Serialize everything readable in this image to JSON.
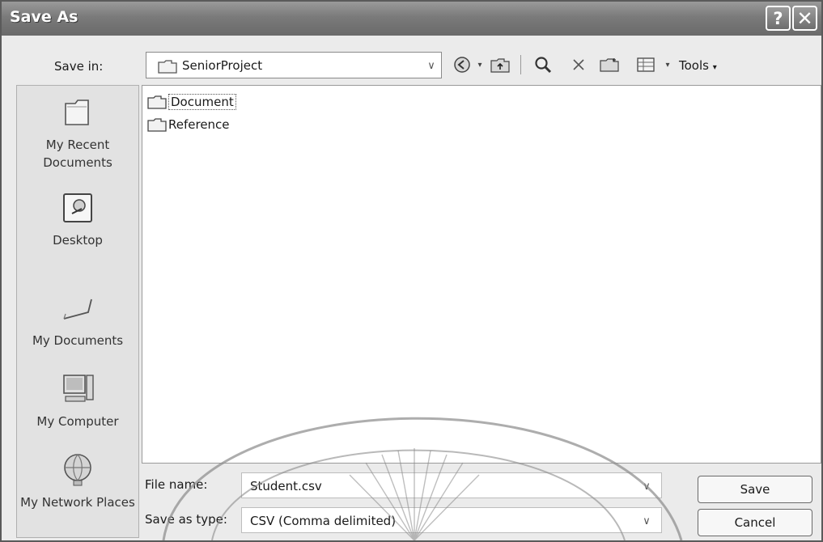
{
  "window": {
    "title": "Save As",
    "help_glyph": "?",
    "close_glyph": "✕"
  },
  "toolbar": {
    "save_in_label": "Save in:",
    "save_in_value": "SeniorProject",
    "icons": [
      "back-icon",
      "dropdown-arrow-icon",
      "up-folder-icon",
      "search-web-icon",
      "delete-icon",
      "new-folder-icon",
      "views-icon",
      "dropdown-arrow-icon"
    ],
    "tools_label": "Tools"
  },
  "places": [
    {
      "label": "My Recent Documents",
      "icon": "recent-documents-icon"
    },
    {
      "label": "Desktop",
      "icon": "desktop-icon"
    },
    {
      "label": "My Documents",
      "icon": "my-documents-icon"
    },
    {
      "label": "My Computer",
      "icon": "my-computer-icon"
    },
    {
      "label": "My Network Places",
      "icon": "network-places-icon"
    }
  ],
  "files": [
    {
      "name": "Document",
      "selected": true
    },
    {
      "name": "Reference",
      "selected": false
    }
  ],
  "form": {
    "file_name_label": "File name:",
    "file_name_value": "Student.csv",
    "save_as_type_label": "Save as type:",
    "save_as_type_value": "CSV (Comma delimited)"
  },
  "buttons": {
    "save": "Save",
    "cancel": "Cancel"
  }
}
